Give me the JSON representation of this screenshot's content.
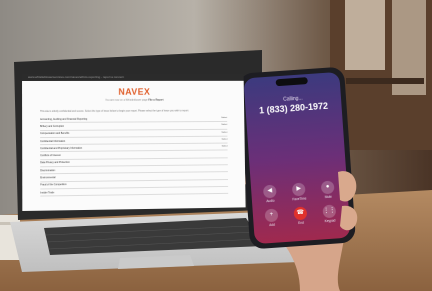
{
  "laptop_screen": {
    "url": "www.whistleblowerservices.com/navex/ethics-reporting - report a concern",
    "brand": "NAVEX",
    "tagline": "You are now on a Whistleblower page ",
    "tagline_link": "File a Report",
    "intro": "This site is strictly confidential and secure. Select the type of issue below to begin your report. Please select the type of issue you wish to report.",
    "rows": [
      {
        "label": "Accounting, Auditing and Financial Reporting",
        "action": "Select"
      },
      {
        "label": "Bribery and Corruption",
        "action": "Select"
      },
      {
        "label": "Compensation and Benefits",
        "action": "Select"
      },
      {
        "label": "Confidential Information",
        "action": "Select"
      },
      {
        "label": "Confidential and Proprietary Information",
        "action": "Select"
      },
      {
        "label": "Conflicts of Interest",
        "action": ""
      },
      {
        "label": "Data Privacy and Protection",
        "action": ""
      },
      {
        "label": "Discrimination",
        "action": ""
      },
      {
        "label": "Environmental",
        "action": ""
      },
      {
        "label": "Fraud of the Competition",
        "action": ""
      },
      {
        "label": "Insider Trade",
        "action": ""
      }
    ]
  },
  "phone": {
    "status": "Calling...",
    "number": "1 (833) 280-1972",
    "controls": [
      {
        "icon": "speaker-icon",
        "glyph": "◀",
        "label": "Audio"
      },
      {
        "icon": "video-icon",
        "glyph": "▶",
        "label": "FaceTime"
      },
      {
        "icon": "mute-icon",
        "glyph": "●",
        "label": "Mute"
      },
      {
        "icon": "add-call-icon",
        "glyph": "+",
        "label": "Add"
      },
      {
        "icon": "end-call-icon",
        "glyph": "☎",
        "label": "End"
      },
      {
        "icon": "keypad-icon",
        "glyph": "⋮⋮",
        "label": "Keypad"
      }
    ],
    "colors": {
      "end_call": "#e0312c",
      "screen_top": "#4a3f8f",
      "screen_bottom": "#a0294e"
    }
  },
  "brand_color": "#e0602d"
}
